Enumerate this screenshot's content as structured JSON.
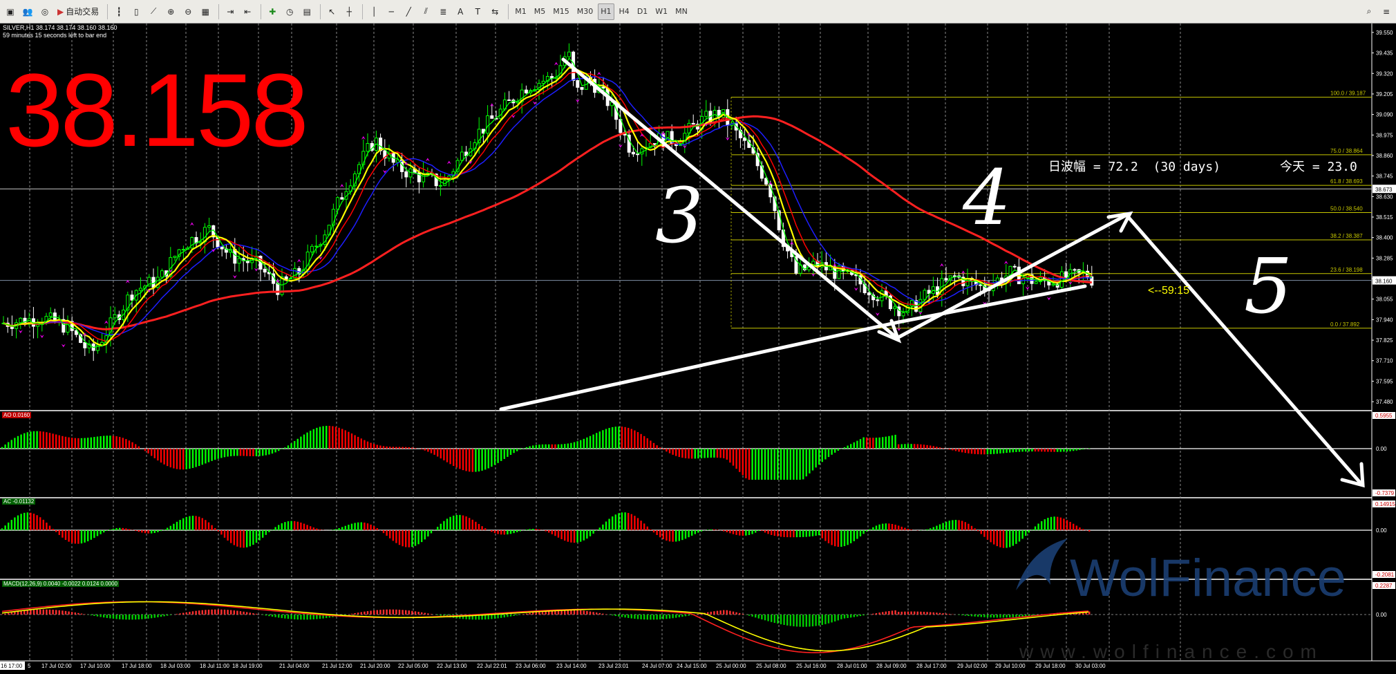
{
  "toolbar": {
    "auto_trade_label": "自动交易",
    "timeframes": [
      "M1",
      "M5",
      "M15",
      "M30",
      "H1",
      "H4",
      "D1",
      "W1",
      "MN"
    ],
    "active_timeframe": "H1"
  },
  "symbol_info": "SILVER,H1  38.174 38.174 38.160 38.160",
  "bar_timer": "59 minutes 15 seconds left to bar end",
  "big_price": "38.158",
  "stats": {
    "range_label": "日波幅 = 72.2  (30 days)",
    "today_label": "今天 = 23.0"
  },
  "countdown": "<--59:15",
  "handwritten_marks": [
    "3",
    "4",
    "5"
  ],
  "price_axis": [
    "39.550",
    "39.435",
    "39.320",
    "39.205",
    "39.090",
    "38.975",
    "38.860",
    "38.745",
    "38.630",
    "38.515",
    "38.400",
    "38.285",
    "38.170",
    "38.055",
    "37.940",
    "37.825",
    "37.710",
    "37.595",
    "37.480"
  ],
  "current_price_tag": "38.160",
  "grey_line_tag": "38.673",
  "fib_levels": [
    {
      "label": "100.0 / 39.187",
      "price": 39.187
    },
    {
      "label": "75.0 / 38.864",
      "price": 38.864
    },
    {
      "label": "61.8 / 38.693",
      "price": 38.693
    },
    {
      "label": "50.0 / 38.540",
      "price": 38.54
    },
    {
      "label": "38.2 / 38.387",
      "price": 38.387
    },
    {
      "label": "23.6 / 38.198",
      "price": 38.198
    },
    {
      "label": "0.0 / 37.892",
      "price": 37.892
    }
  ],
  "time_axis": [
    "16 17:00",
    "5",
    "17 Jul 02:00",
    "17 Jul 10:00",
    "17 Jul 18:00",
    "18 Jul 03:00",
    "18 Jul 11:00",
    "18 Jul 19:00",
    "21 Jul 04:00",
    "21 Jul 12:00",
    "21 Jul 20:00",
    "22 Jul 05:00",
    "22 Jul 13:00",
    "22 Jul 22:01",
    "23 Jul 06:00",
    "23 Jul 14:00",
    "23 Jul 23:01",
    "24 Jul 07:00",
    "24 Jul 15:00",
    "25 Jul 00:00",
    "25 Jul 08:00",
    "25 Jul 16:00",
    "28 Jul 01:00",
    "28 Jul 09:00",
    "28 Jul 17:00",
    "29 Jul 02:00",
    "29 Jul 10:00",
    "29 Jul 18:00",
    "30 Jul 03:00"
  ],
  "indicators": {
    "ao": {
      "label": "AO 0.0160",
      "top": "0.5955",
      "zero": "0.00",
      "bottom": "-0.7379"
    },
    "ac": {
      "label": "AC -0.01132",
      "top": "0.14915",
      "zero": "0.00",
      "bottom": "-0.2081"
    },
    "macd": {
      "label": "MACD(12,26,9) 0.0040 -0.0022 0.0124 0.0000",
      "top": "0.2287",
      "zero": "0.00",
      "bottom": "-0.2653"
    }
  },
  "watermark": {
    "brand": "WolFinance",
    "url": "www.wolfinance.com"
  },
  "colors": {
    "bull": "#00ff00",
    "bear": "#ff0000",
    "ma_fast": "#00ff00",
    "ma_yellow": "#ffff00",
    "ma_red": "#ff0000",
    "ma_blue": "#1e1eff",
    "ma_long": "#ff2020",
    "grid": "#8a8a8a",
    "fib": "#c8c800",
    "price_text": "#ff0000"
  }
}
